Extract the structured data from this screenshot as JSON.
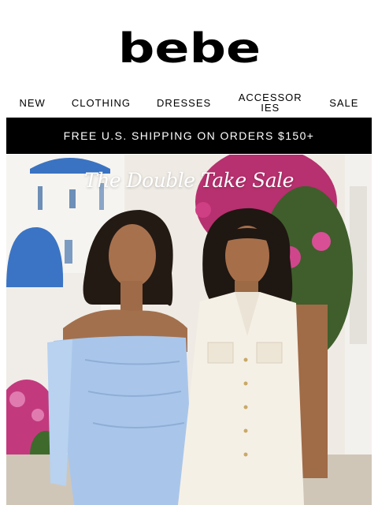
{
  "brand": {
    "logo_text": "bebe"
  },
  "nav": {
    "items": [
      {
        "label": "NEW"
      },
      {
        "label": "CLOTHING"
      },
      {
        "label": "DRESSES"
      },
      {
        "label": "ACCESSORIES"
      },
      {
        "label": "SALE"
      }
    ]
  },
  "banner": {
    "text": "FREE U.S. SHIPPING ON ORDERS $150+"
  },
  "hero": {
    "title": "The Double Take Sale",
    "colors": {
      "sky": "#f2efe9",
      "dome": "#3b74c4",
      "wall": "#f4f2ee",
      "flowers": "#c2327c",
      "dress_blue": "#a9c7ea",
      "jumpsuit": "#f4efe4"
    }
  }
}
